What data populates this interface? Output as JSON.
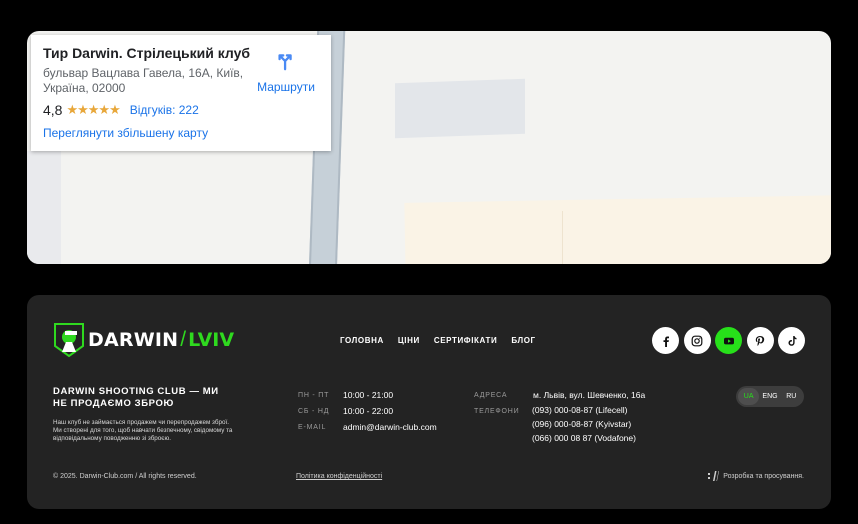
{
  "map": {
    "place_name": "Тир Darwin. Стрілецький клуб",
    "address": "бульвар Вацлава Гавела, 16А, Київ, Україна, 02000",
    "rating": "4,8",
    "stars": "★★★★★",
    "reviews": "Відгуків: 222",
    "larger_map_link": "Переглянути збільшену карту",
    "directions_label": "Маршрути"
  },
  "footer": {
    "logo": {
      "brand": "DARWIN",
      "sep": "/",
      "city": "LVIV"
    },
    "nav": [
      "ГОЛОВНА",
      "ЦІНИ",
      "СЕРТИФІКАТИ",
      "БЛОГ"
    ],
    "socials": [
      {
        "name": "facebook-icon",
        "glyph": "f"
      },
      {
        "name": "instagram-icon",
        "glyph": ""
      },
      {
        "name": "youtube-icon",
        "glyph": ""
      },
      {
        "name": "pinterest-icon",
        "glyph": "P"
      },
      {
        "name": "tiktok-icon",
        "glyph": "♪"
      }
    ],
    "tagline": "DARWIN SHOOTING CLUB — МИ НЕ ПРОДАЄМО ЗБРОЮ",
    "description": "Наш клуб не займається продажем чи перепродажем зброї. Ми створені для того, щоб навчати безпечному, свідомому та відповідальному поводженню зі зброєю.",
    "hours": [
      {
        "label": "ПН - ПТ",
        "value": "10:00 - 21:00"
      },
      {
        "label": "СБ - НД",
        "value": "10:00 - 22:00"
      },
      {
        "label": "E-MAIL",
        "value": "admin@darwin-club.com"
      }
    ],
    "address_label": "АДРЕСА",
    "address_value": "м. Львів, вул. Шевченко, 16а",
    "phones_label": "ТЕЛЕФОНИ",
    "phones": [
      "(093) 000-08-87 (Lifecell)",
      "(096) 000-08-87 (Kyivstar)",
      "(066) 000 08 87 (Vodafone)"
    ],
    "languages": [
      "UA",
      "ENG",
      "RU"
    ],
    "active_language": "UA",
    "copyright": "© 2025. Darwin-Club.com / All rights reserved.",
    "privacy": "Політика конфіденційності",
    "developer": "Розробка та просування."
  },
  "colors": {
    "accent": "#27e01a",
    "footer_bg": "#232323",
    "link": "#1a73e8",
    "star": "#e8a73a"
  }
}
